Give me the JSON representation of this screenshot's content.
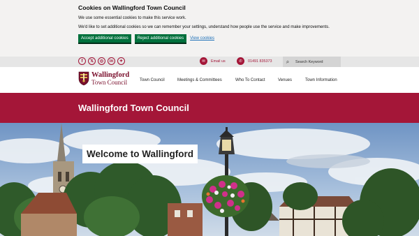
{
  "cookie_banner": {
    "title": "Cookies on Wallingford Town Council",
    "line1": "We use some essential cookies to make this service work.",
    "line2": "We'd like to set additional cookies so we can remember your settings, understand how people use the service and make improvements.",
    "accept_label": "Accept additional cookies",
    "reject_label": "Reject additional cookies",
    "view_label": "View cookies"
  },
  "utility_bar": {
    "social_icons": [
      {
        "name": "facebook-icon",
        "glyph": "f"
      },
      {
        "name": "x-twitter-icon",
        "glyph": "𝕏"
      },
      {
        "name": "instagram-icon",
        "glyph": "◎"
      },
      {
        "name": "linkedin-icon",
        "glyph": "in"
      },
      {
        "name": "bluesky-icon",
        "glyph": "✦"
      }
    ],
    "email_label": "Email us",
    "phone_label": "01491 835373",
    "search_placeholder": "Search Keyword"
  },
  "header": {
    "logo_line1": "Wallingford",
    "logo_line2": "Town Council",
    "nav": [
      "Town Council",
      "Meetings & Committees",
      "Who To Contact",
      "Venues",
      "Town Information"
    ]
  },
  "page_title": "Wallingford Town Council",
  "hero": {
    "welcome": "Welcome to Wallingford"
  },
  "colors": {
    "brand": "#a41638",
    "cookie_button": "#00703c",
    "link": "#1d70b8"
  }
}
